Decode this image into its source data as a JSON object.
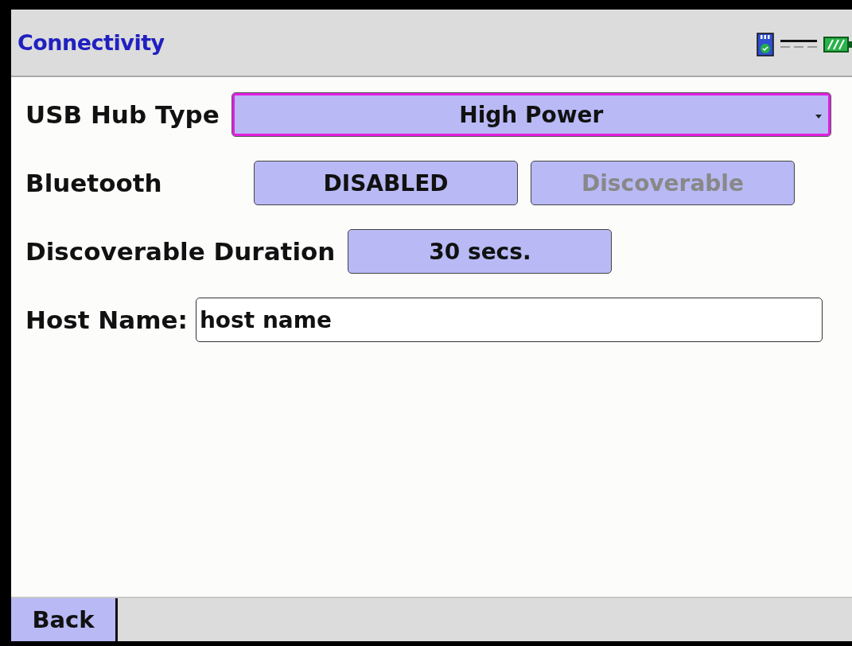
{
  "header": {
    "title": "Connectivity"
  },
  "usb_hub_type": {
    "label": "USB Hub Type",
    "value": "High Power",
    "focused": true
  },
  "bluetooth": {
    "label": "Bluetooth",
    "buttons": [
      {
        "label": "DISABLED",
        "disabled": false
      },
      {
        "label": "Discoverable",
        "disabled": true
      }
    ]
  },
  "discoverable_duration": {
    "label": "Discoverable Duration",
    "value": "30 secs."
  },
  "host_name": {
    "label": "Host Name:",
    "value": "host name"
  },
  "footer": {
    "buttons": [
      "Back"
    ]
  }
}
